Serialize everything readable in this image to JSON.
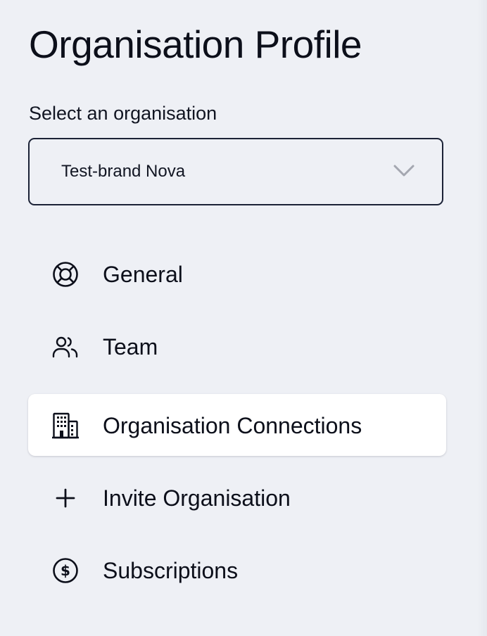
{
  "page": {
    "title": "Organisation Profile"
  },
  "org_select": {
    "label": "Select an organisation",
    "value": "Test-brand Nova"
  },
  "nav": {
    "items": [
      {
        "label": "General",
        "icon": "lifebuoy-icon",
        "active": false
      },
      {
        "label": "Team",
        "icon": "users-icon",
        "active": false
      },
      {
        "label": "Organisation Connections",
        "icon": "building-icon",
        "active": true
      },
      {
        "label": "Invite Organisation",
        "icon": "plus-icon",
        "active": false
      },
      {
        "label": "Subscriptions",
        "icon": "dollar-circle-icon",
        "active": false
      }
    ]
  },
  "colors": {
    "background": "#eef0f5",
    "active_item_background": "#ffffff",
    "text": "#0c0f1a",
    "select_border": "#1b2236",
    "chevron": "#a4a7b0"
  }
}
